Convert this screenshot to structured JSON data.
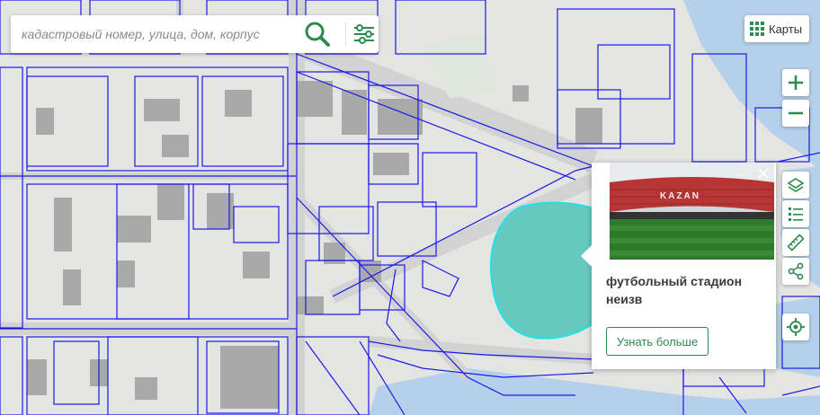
{
  "search": {
    "placeholder": "кадастровый номер, улица, дом, корпус"
  },
  "map_switch": {
    "label": "Карты"
  },
  "popup": {
    "photo_sign": "KAZAN",
    "title": "футбольный стадион неизв",
    "more_button": "Узнать больше"
  },
  "colors": {
    "accent": "#2e8b4f",
    "parcel_outline": "#1a1ae6",
    "stadium_fill": "#66c9c0",
    "water": "#b5d0ea",
    "background": "#e4e4e2",
    "road": "#d2d2d2"
  },
  "icons": {
    "search": "search-icon",
    "filter": "filter-sliders-icon",
    "maps": "grid-icon",
    "zoom_in": "plus-icon",
    "zoom_out": "minus-icon",
    "layers": "layers-icon",
    "legend": "list-icon",
    "measure": "ruler-icon",
    "share": "share-icon",
    "locate": "location-icon",
    "close": "close-icon"
  }
}
